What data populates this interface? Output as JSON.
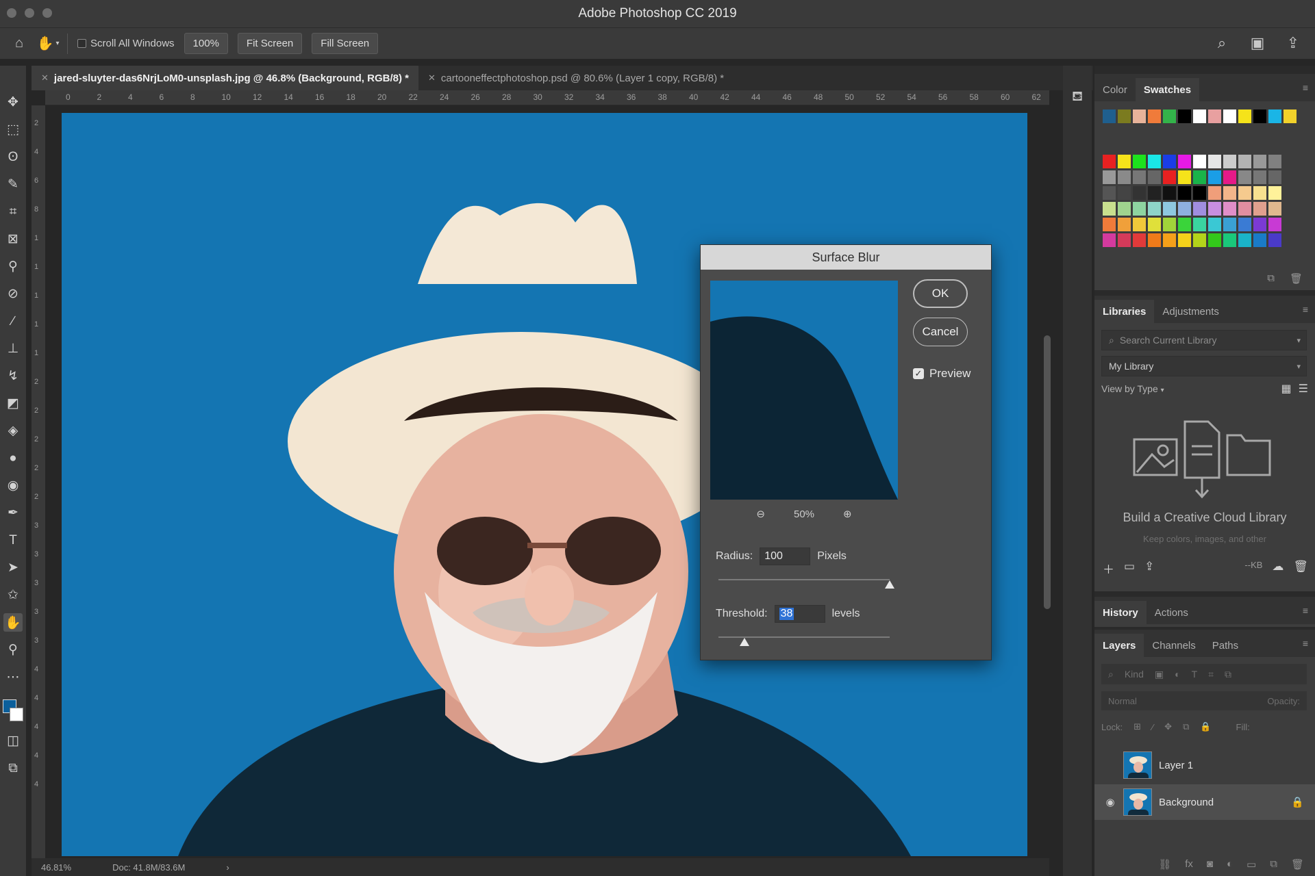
{
  "window": {
    "title": "Adobe Photoshop CC 2019"
  },
  "options_bar": {
    "scroll_all_windows": "Scroll All Windows",
    "zoom": "100%",
    "fit_screen": "Fit Screen",
    "fill_screen": "Fill Screen"
  },
  "tabs": [
    {
      "label": "jared-sluyter-das6NrjLoM0-unsplash.jpg @ 46.8% (Background, RGB/8) *",
      "active": true
    },
    {
      "label": "cartooneffectphotoshop.psd @ 80.6% (Layer 1 copy, RGB/8) *",
      "active": false
    }
  ],
  "ruler": {
    "top": [
      "0",
      "2",
      "4",
      "6",
      "8",
      "10",
      "12",
      "14",
      "16",
      "18",
      "20",
      "22",
      "24",
      "26",
      "28",
      "30",
      "32",
      "34",
      "36",
      "38",
      "40",
      "42",
      "44",
      "46",
      "48",
      "50",
      "52",
      "54",
      "56",
      "58",
      "60",
      "62"
    ],
    "left": [
      "2",
      "4",
      "6",
      "8",
      "1",
      "1",
      "1",
      "1",
      "1",
      "2",
      "2",
      "2",
      "2",
      "2",
      "3",
      "3",
      "3",
      "3",
      "3",
      "4",
      "4",
      "4",
      "4",
      "4"
    ]
  },
  "status": {
    "zoom": "46.81%",
    "doc": "Doc: 41.8M/83.6M"
  },
  "dialog": {
    "title": "Surface Blur",
    "ok": "OK",
    "cancel": "Cancel",
    "preview_label": "Preview",
    "preview_checked": true,
    "zoom": "50%",
    "radius": {
      "label": "Radius:",
      "value": "100",
      "unit": "Pixels",
      "slider": 1.0
    },
    "threshold": {
      "label": "Threshold:",
      "value": "38",
      "unit": "levels",
      "slider": 0.15
    }
  },
  "panels": {
    "color_tabs": [
      "Color",
      "Swatches"
    ],
    "recent_swatches": [
      "#1f5f8e",
      "#7b7b1f",
      "#e8b39a",
      "#f07b3a",
      "#33b34a",
      "#000000",
      "#ffffff",
      "#e8a0a0",
      "#ffffff",
      "#f5e31a",
      "#000000",
      "#1ab5e6",
      "#f2d22b"
    ],
    "swatches": [
      "#e82121",
      "#f5e31a",
      "#1de21d",
      "#1ae6e6",
      "#1a3de6",
      "#e61ae6",
      "#ffffff",
      "#e6e6e6",
      "#cccccc",
      "#b3b3b3",
      "#999999",
      "#808080",
      "#999999",
      "#8a8a8a",
      "#777777",
      "#666666",
      "#e82121",
      "#f5e31a",
      "#1ab34a",
      "#1a9ee6",
      "#e61a88",
      "#888888",
      "#777777",
      "#666666",
      "#555555",
      "#444444",
      "#333333",
      "#222222",
      "#111111",
      "#000000",
      "#000000",
      "#f09e7a",
      "#f2b58a",
      "#f5ca8e",
      "#f7e08f",
      "#fff29a",
      "#c8e08e",
      "#a0d48e",
      "#8ed4a0",
      "#8ed4c8",
      "#8ec8e0",
      "#8eb0e0",
      "#a08ee0",
      "#c88ee0",
      "#e08ec8",
      "#e08ea0",
      "#e0a08e",
      "#e0b88e",
      "#f07b3a",
      "#f0a03a",
      "#f0c83a",
      "#e0e03a",
      "#a0d43a",
      "#3ad43a",
      "#3ad4a0",
      "#3ac8d4",
      "#3aa0d4",
      "#3a7bd4",
      "#7b3ad4",
      "#c83ad4",
      "#d43a9e",
      "#d43a5a",
      "#e23a3a",
      "#f07b1a",
      "#f5a01a",
      "#f5d21a",
      "#b3d41a",
      "#33c81a",
      "#1ac87b",
      "#1ab3c8",
      "#1a7bc8",
      "#4a3ac8"
    ],
    "library_tabs": [
      "Libraries",
      "Adjustments"
    ],
    "library_search_placeholder": "Search Current Library",
    "library_select": "My Library",
    "view_by": "View by Type",
    "library_cta": "Build a Creative Cloud Library",
    "library_sub": "Keep colors, images, and other",
    "library_size": "--KB",
    "history_tabs": [
      "History",
      "Actions"
    ],
    "layers_tabs": [
      "Layers",
      "Channels",
      "Paths"
    ],
    "layers_filter": "Kind",
    "blend_mode": "Normal",
    "opacity_label": "Opacity:",
    "lock_label": "Lock:",
    "fill_label": "Fill:",
    "layers": [
      {
        "name": "Layer 1",
        "visible": false,
        "selected": false
      },
      {
        "name": "Background",
        "visible": true,
        "selected": true
      }
    ]
  }
}
